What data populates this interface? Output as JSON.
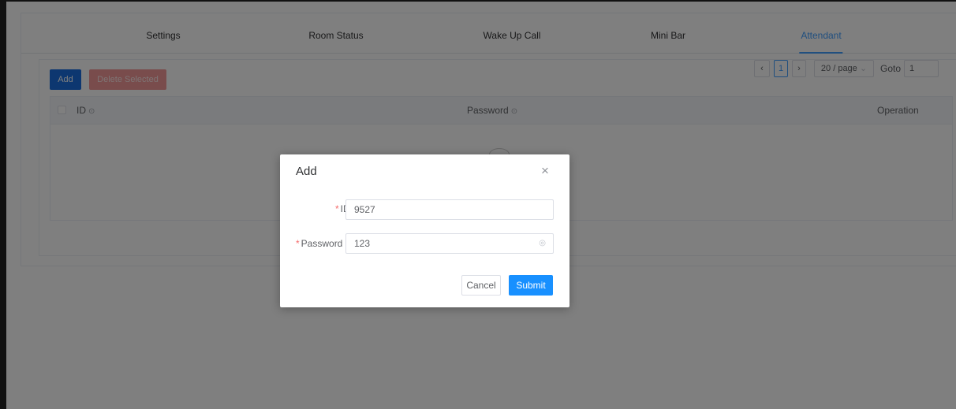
{
  "tabs": [
    {
      "label": "Settings"
    },
    {
      "label": "Room Status"
    },
    {
      "label": "Wake Up Call"
    },
    {
      "label": "Mini Bar"
    },
    {
      "label": "Attendant"
    }
  ],
  "active_tab": "Attendant",
  "toolbar": {
    "add_label": "Add",
    "delete_label": "Delete Selected"
  },
  "table": {
    "columns": [
      {
        "label": "ID",
        "help_icon": "question-circle-icon"
      },
      {
        "label": "Password",
        "help_icon": "question-circle-icon"
      },
      {
        "label": "Operation"
      }
    ],
    "rows": []
  },
  "pagination": {
    "prev_icon": "‹",
    "current_page": "1",
    "next_icon": "›",
    "page_size": "20 / page",
    "goto_label": "Goto",
    "goto_value": "1"
  },
  "modal": {
    "title": "Add",
    "close_icon": "×",
    "fields": {
      "id": {
        "required_mark": "*",
        "label": "ID",
        "value": "9527"
      },
      "password": {
        "required_mark": "*",
        "label": "Password",
        "value": "123"
      }
    },
    "cancel_label": "Cancel",
    "submit_label": "Submit"
  },
  "colors": {
    "accent": "#409eff",
    "primary_button": "#1890ff",
    "danger_disabled": "#f39898"
  }
}
